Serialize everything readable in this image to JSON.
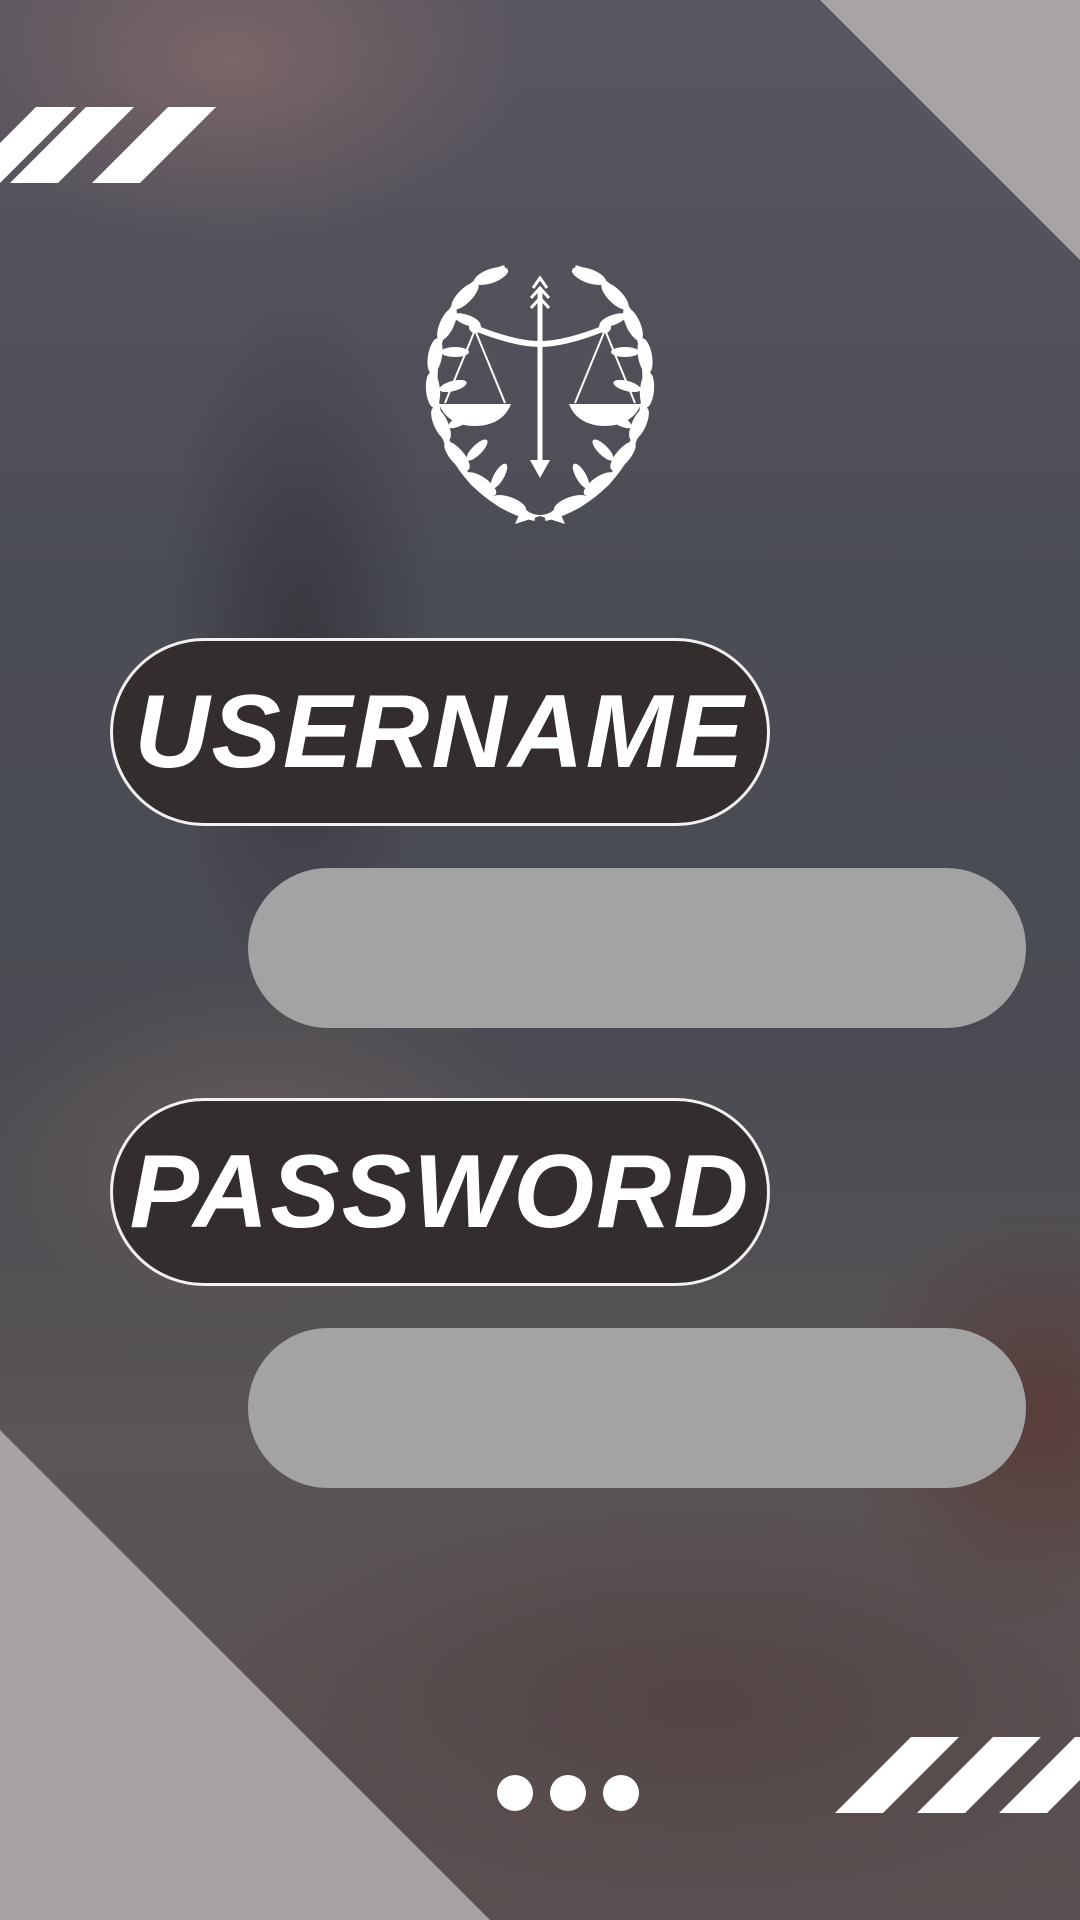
{
  "username": {
    "label": "USERNAME",
    "value": "",
    "placeholder": ""
  },
  "password": {
    "label": "PASSWORD",
    "value": "",
    "placeholder": ""
  },
  "logo": {
    "icon": "scales-of-justice-laurel-icon"
  },
  "pagination": {
    "dots": 3
  },
  "colors": {
    "label_pill": "#332d2e",
    "field": "#a3a3a3",
    "accent_light": "#ffffff"
  }
}
